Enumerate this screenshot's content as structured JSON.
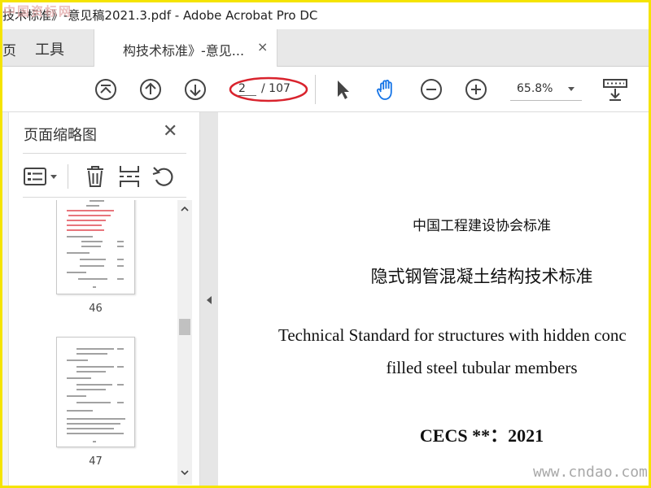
{
  "watermark_top": "中国资标网",
  "watermark_bottom": "www.cndao.com",
  "window_title": "技术标准》-意见稿2021.3.pdf - Adobe Acrobat Pro DC",
  "tabs": {
    "clipped_left": "页",
    "tools": "工具",
    "active": "构技术标准》-意见...",
    "close": "×"
  },
  "toolbar": {
    "page_current": "2",
    "page_total": "/ 107",
    "zoom": "65.8%",
    "icons": [
      "first-page-icon",
      "prev-page-icon",
      "next-page-icon",
      "select-arrow-icon",
      "hand-tool-icon",
      "zoom-out-icon",
      "zoom-in-icon",
      "zoom-dropdown-icon",
      "keyboard-tools-icon"
    ],
    "accent_color": "#1473e6",
    "highlight_color": "#d9232d"
  },
  "sidebar": {
    "title": "页面缩略图",
    "close": "✕",
    "tool_icons": [
      "options-menu-icon",
      "delete-page-icon",
      "crop-page-icon",
      "rotate-page-icon"
    ],
    "thumbnails": [
      {
        "label": "46"
      },
      {
        "label": "47"
      }
    ]
  },
  "document": {
    "org": "中国工程建设协会标准",
    "title_cn": "隐式钢管混凝土结构技术标准",
    "title_en_line1": "Technical Standard for structures with hidden conc",
    "title_en_line2": "filled steel tubular members",
    "code": "CECS **：2021"
  }
}
